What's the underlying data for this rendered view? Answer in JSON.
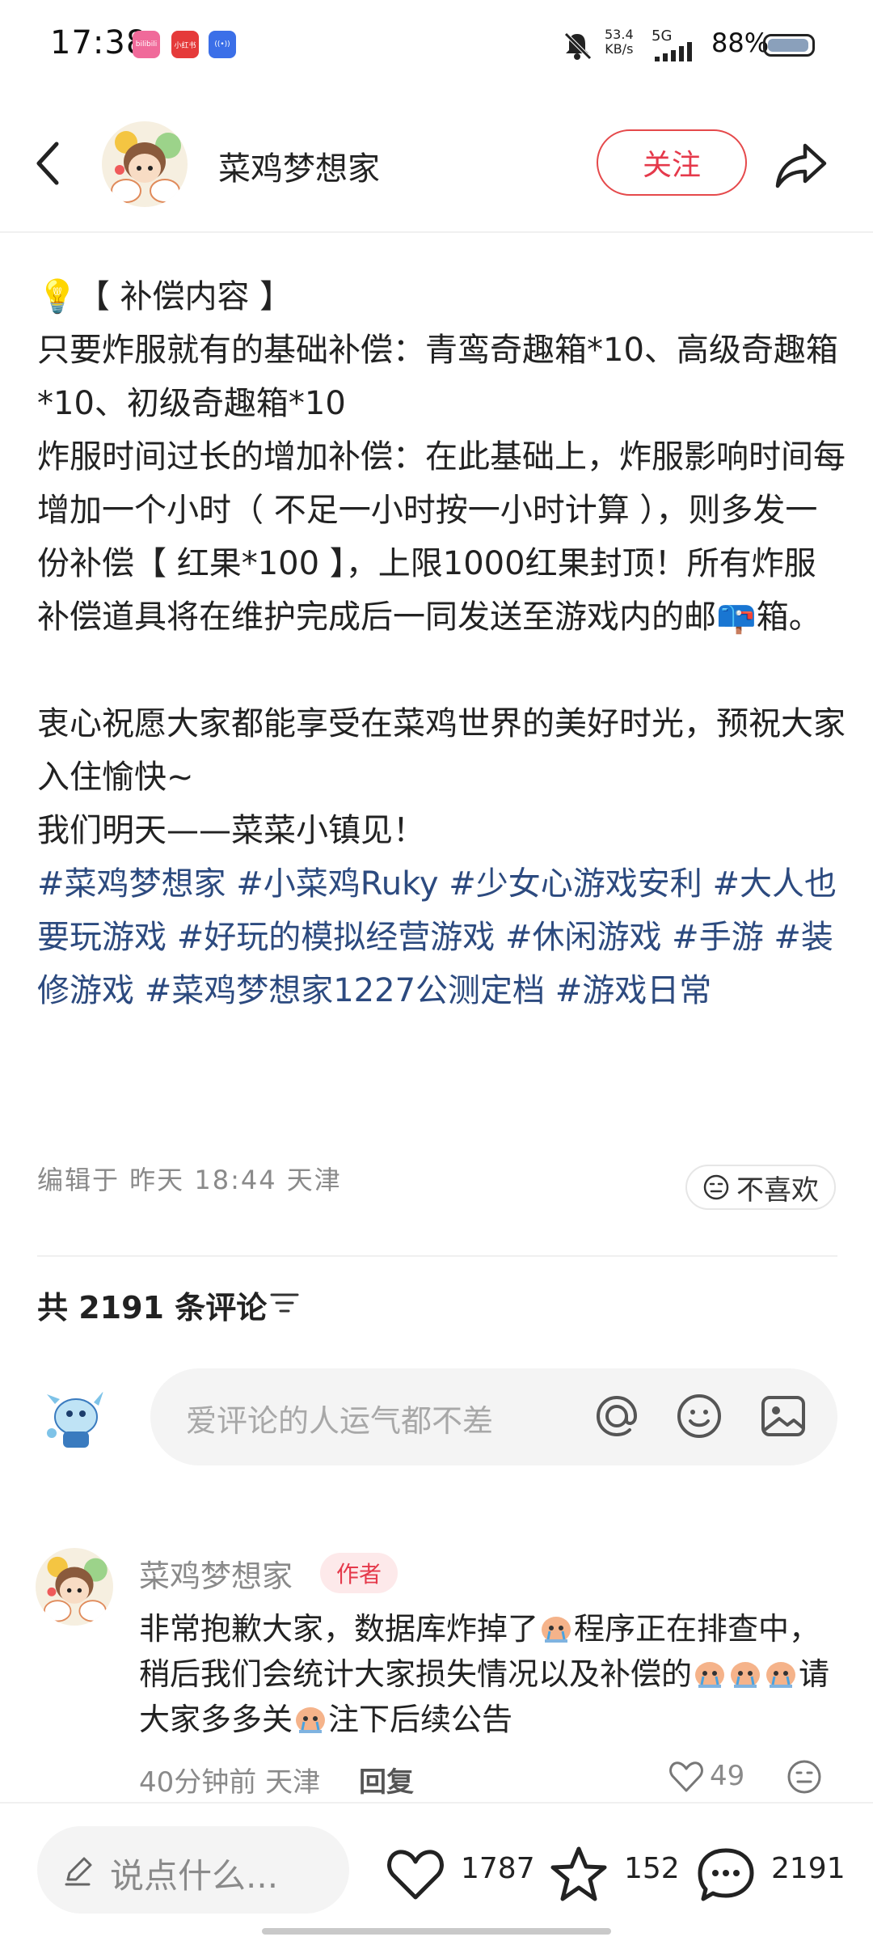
{
  "status_bar": {
    "time": "17:38",
    "apps": [
      "bilibili",
      "小红书",
      "((•))"
    ],
    "net_speed": "53.4",
    "net_unit": "KB/s",
    "network": "5G",
    "battery": "88%",
    "battery_level": 0.88
  },
  "header": {
    "author_name": "菜鸡梦想家",
    "follow_label": "关注"
  },
  "post": {
    "paragraphs": [
      "💡【 补偿内容 】",
      "只要炸服就有的基础补偿：青鸾奇趣箱*10、高级奇趣箱*10、初级奇趣箱*10",
      "炸服时间过长的增加补偿：在此基础上，炸服影响时间每增加一个小时（ 不足一小时按一小时计算 ），则多发一份补偿【 红果*100 】，上限1000红果封顶！所有炸服补偿道具将在维护完成后一同发送至游戏内的邮📪箱。",
      "",
      "衷心祝愿大家都能享受在菜鸡世界的美好时光，预祝大家入住愉快~",
      "我们明天——菜菜小镇见！"
    ],
    "hashtags": "#菜鸡梦想家 #小菜鸡Ruky #少女心游戏安利 #大人也要玩游戏 #好玩的模拟经营游戏 #休闲游戏 #手游 #装修游戏 #菜鸡梦想家1227公测定档 #游戏日常",
    "edit_meta": "编辑于 昨天 18:44 天津",
    "dislike_label": "不喜欢"
  },
  "comments_section": {
    "count_label": "共 2191 条评论",
    "input_placeholder": "爱评论的人运气都不差"
  },
  "comment": {
    "name": "菜鸡梦想家",
    "badge": "作者",
    "text_part1": "非常抱歉大家，数据库炸掉了",
    "text_part2": "程序正在排查中，稍后我们会统计大家损失情况以及补偿的",
    "text_part3": "请大家多多关",
    "text_part4": "注下后续公告",
    "meta": "40分钟前 天津",
    "reply_label": "回复",
    "likes": "49"
  },
  "bottom_bar": {
    "say_placeholder": "说点什么...",
    "likes": "1787",
    "collects": "152",
    "comments": "2191"
  }
}
